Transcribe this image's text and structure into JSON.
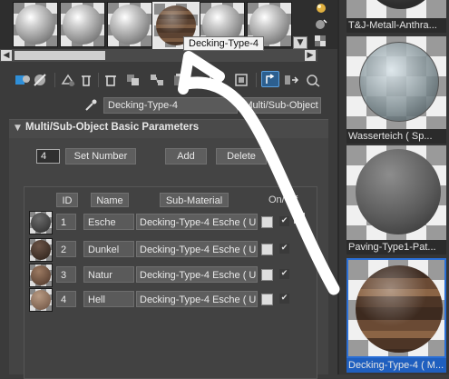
{
  "tooltip": "Decking-Type-4",
  "material_name": "Decking-Type-4",
  "material_type_button": "Multi/Sub-Object",
  "rollout_title": "Multi/Sub-Object Basic Parameters",
  "number_value": "4",
  "buttons": {
    "set_number": "Set Number",
    "add": "Add",
    "delete": "Delete"
  },
  "headers": {
    "id": "ID",
    "name": "Name",
    "submaterial": "Sub-Material",
    "onoff": "On/Off"
  },
  "rows": [
    {
      "id": "1",
      "name": "Esche",
      "sub": "Decking-Type-4 Esche  ( Ur",
      "on": true
    },
    {
      "id": "2",
      "name": "Dunkel",
      "sub": "Decking-Type-4 Esche  ( Ur",
      "on": true
    },
    {
      "id": "3",
      "name": "Natur",
      "sub": "Decking-Type-4 Esche  ( Ur",
      "on": true
    },
    {
      "id": "4",
      "name": "Hell",
      "sub": "Decking-Type-4 Esche  ( Ur",
      "on": true
    }
  ],
  "right_panel": {
    "labels": [
      "T&J-Metall-Anthra...",
      "Wasserteich  ( Sp...",
      "Paving-Type1-Pat...",
      "Decking-Type-4  ( M..."
    ]
  },
  "icons": {
    "strip": [
      "sphere-slot",
      "sphere-slot",
      "sphere-slot",
      "wood-sphere-slot",
      "sphere-slot",
      "sphere-slot"
    ],
    "toolbar": [
      "get-material-icon",
      "put-to-scene-icon",
      "assign-material-icon",
      "reset-icon",
      "copy-icon",
      "unique-icon",
      "put-library-icon",
      "effects-channel-icon",
      "show-map-icon",
      "show-end-result-icon",
      "go-parent-icon",
      "go-sibling-icon",
      "eyedropper-icon"
    ]
  },
  "colors": {
    "accent": "#1e8fe0",
    "panel_bg": "#3b3b3b",
    "selected_border": "#2a6fd6"
  }
}
